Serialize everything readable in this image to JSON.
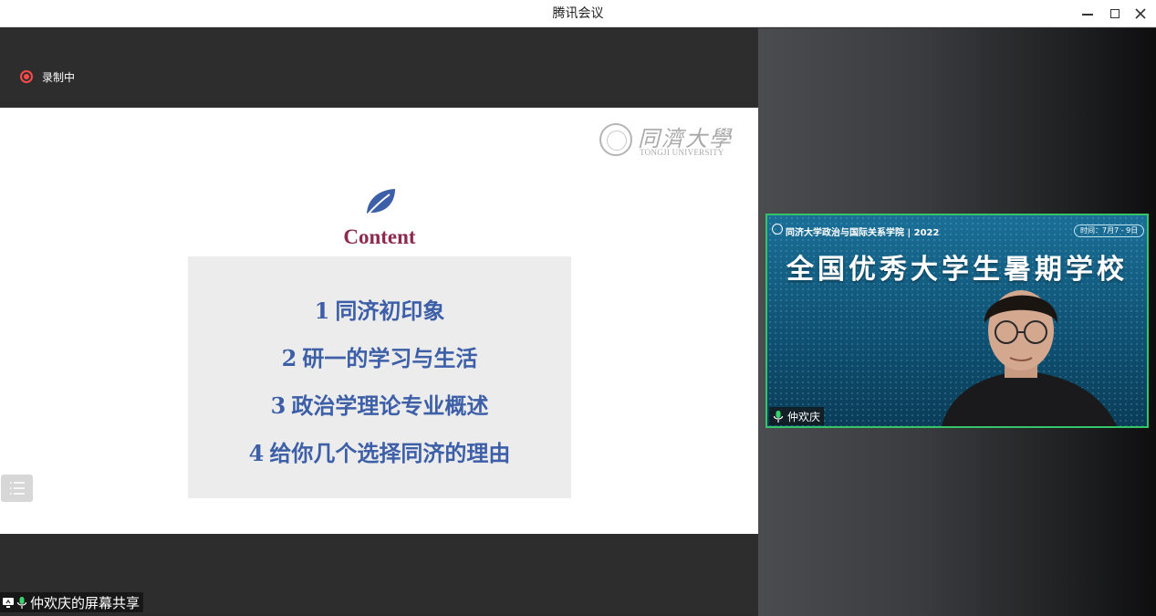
{
  "window": {
    "title": "腾讯会议",
    "minimize_icon": "minimize-icon",
    "maximize_icon": "maximize-icon",
    "close_icon": "close-icon"
  },
  "recording": {
    "label": "录制中",
    "color": "#ff4a4a"
  },
  "slide": {
    "logo_cn": "同濟大學",
    "logo_en": "TONGJI UNIVERSITY",
    "heading": "Content",
    "heading_color": "#8d2a4d",
    "item_color": "#3d5fa8",
    "items": [
      {
        "num": "1",
        "text": "同济初印象"
      },
      {
        "num": "2",
        "text": "研一的学习与生活"
      },
      {
        "num": "3",
        "text": "政治学理论专业概述"
      },
      {
        "num": "4",
        "text": "给你几个选择同济的理由"
      }
    ]
  },
  "share": {
    "label": "仲欢庆的屏幕共享"
  },
  "participant": {
    "name": "仲欢庆",
    "banner_school": "同济大学政治与国际关系学院 | 2022",
    "banner_time": "时间：7月7 - 9日",
    "banner_title": "全国优秀大学生暑期学校",
    "border_color": "#35c46a"
  }
}
